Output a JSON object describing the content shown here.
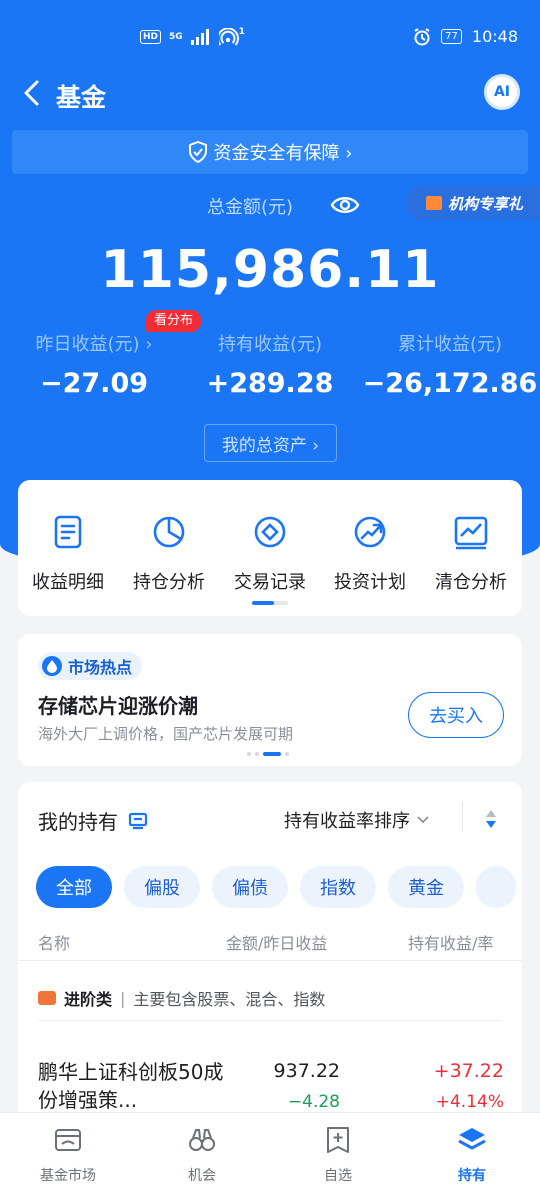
{
  "status_bar": {
    "network": "HD",
    "signal": "5G",
    "hotspot_suffix": "1",
    "battery": "77",
    "time": "10:48"
  },
  "header": {
    "title": "基金",
    "ai_label": "AI"
  },
  "safety_banner": "资金安全有保障 ›",
  "summary": {
    "total_label": "总金额(元)",
    "total_amount": "115,986.11",
    "institution_tag": "机构专享礼",
    "distribution_badge": "看分布",
    "stats": [
      {
        "label": "昨日收益(元) ›",
        "value": "−27.09"
      },
      {
        "label": "持有收益(元)",
        "value": "+289.28"
      },
      {
        "label": "累计收益(元)",
        "value": "−26,172.86"
      }
    ],
    "total_assets_button": "我的总资产 ›"
  },
  "tools": [
    {
      "label": "收益明细",
      "icon": "document-icon"
    },
    {
      "label": "持仓分析",
      "icon": "pie-chart-icon"
    },
    {
      "label": "交易记录",
      "icon": "diamond-circle-icon"
    },
    {
      "label": "投资计划",
      "icon": "trend-up-icon"
    },
    {
      "label": "清仓分析",
      "icon": "chart-box-icon"
    }
  ],
  "market_hot": {
    "tag": "市场热点",
    "title": "存储芯片迎涨价潮",
    "subtitle": "海外大厂上调价格，国产芯片发展可期",
    "button": "去买入"
  },
  "holdings": {
    "title": "我的持有",
    "sort_label": "持有收益率排序",
    "filters": [
      "全部",
      "偏股",
      "偏债",
      "指数",
      "黄金"
    ],
    "columns": [
      "名称",
      "金额/昨日收益",
      "持有收益/率"
    ],
    "category_name": "进阶类",
    "category_desc": "主要包含股票、混合、指数",
    "funds": [
      {
        "name": "鹏华上证科创板50成份增强策...",
        "amount": "937.22",
        "yesterday": "−4.28",
        "hold_profit": "+37.22",
        "hold_rate": "+4.14%"
      }
    ]
  },
  "tabbar": [
    {
      "label": "基金市场",
      "icon": "market-icon"
    },
    {
      "label": "机会",
      "icon": "binoculars-icon"
    },
    {
      "label": "自选",
      "icon": "add-favorite-icon"
    },
    {
      "label": "持有",
      "icon": "layers-icon",
      "active": true
    }
  ],
  "colors": {
    "primary": "#1a76f4",
    "up": "#e8313a",
    "down": "#1a9e5a"
  }
}
